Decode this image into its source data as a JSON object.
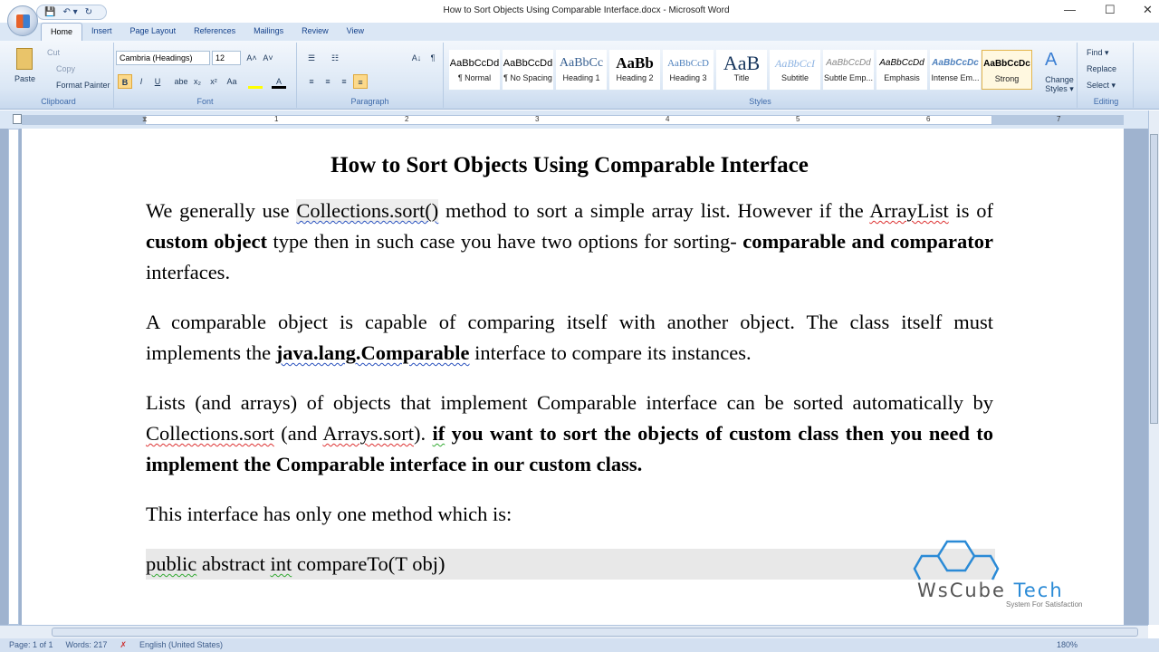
{
  "window": {
    "title": "How to Sort Objects Using Comparable Interface.docx - Microsoft Word",
    "minimize": "—",
    "maximize": "☐",
    "close": "✕"
  },
  "qat": {
    "save": "💾",
    "undo": "↶ ▾",
    "redo": "↻",
    "customize": "₹"
  },
  "tabs": [
    "Home",
    "Insert",
    "Page Layout",
    "References",
    "Mailings",
    "Review",
    "View"
  ],
  "clipboard": {
    "paste": "Paste",
    "cut": "Cut",
    "copy": "Copy",
    "format_painter": "Format Painter",
    "label": "Clipboard"
  },
  "font": {
    "name": "Cambria (Headings)",
    "size": "12",
    "label": "Font",
    "bold": "B",
    "italic": "I",
    "underline": "U",
    "strike": "abe",
    "sub": "x₂",
    "sup": "x²",
    "case": "Aa",
    "grow": "A˄",
    "shrink": "A˅",
    "color": "A"
  },
  "paragraph": {
    "label": "Paragraph",
    "pilcrow": "¶",
    "sort": "A↓"
  },
  "styles": {
    "label": "Styles",
    "items": [
      {
        "preview": "AaBbCcDd",
        "name": "¶ Normal"
      },
      {
        "preview": "AaBbCcDd",
        "name": "¶ No Spacing"
      },
      {
        "preview": "AaBbCc",
        "name": "Heading 1"
      },
      {
        "preview": "AaBb",
        "name": "Heading 2"
      },
      {
        "preview": "AaBbCcD",
        "name": "Heading 3"
      },
      {
        "preview": "AaB",
        "name": "Title"
      },
      {
        "preview": "AaBbCcI",
        "name": "Subtitle"
      },
      {
        "preview": "AaBbCcDd",
        "name": "Subtle Emp..."
      },
      {
        "preview": "AaBbCcDd",
        "name": "Emphasis"
      },
      {
        "preview": "AaBbCcDc",
        "name": "Intense Em..."
      },
      {
        "preview": "AaBbCcDc",
        "name": "Strong"
      }
    ],
    "change_styles": "Change Styles ▾"
  },
  "editing": {
    "label": "Editing",
    "find": "Find ▾",
    "replace": "Replace",
    "select": "Select ▾"
  },
  "ruler": [
    "1",
    "1",
    "2",
    "3",
    "4",
    "5",
    "6",
    "7"
  ],
  "document": {
    "title": "How to Sort Objects Using Comparable Interface",
    "p1": [
      "We generally use ",
      "Collections.sort()",
      " method to sort a simple array list. However if the ",
      "ArrayList",
      " is of ",
      "custom object",
      " type then in such case you have two options for sorting- ",
      "comparable and comparator",
      " interfaces."
    ],
    "p2": [
      "A comparable object is capable of comparing itself with another object. The class itself must implements the ",
      "java.lang.Comparable",
      " interface to compare its instances."
    ],
    "p3": [
      "Lists (and arrays) of objects that implement Comparable interface can be sorted automatically by ",
      "Collections.sort",
      " (and ",
      "Arrays.sort",
      "). ",
      "if",
      " you want to sort the objects of custom class then you need to implement the Comparable interface in our custom class."
    ],
    "p4": "This interface has only one method which is:",
    "code": [
      "public",
      " abstract ",
      "int",
      " compareTo(T obj)"
    ]
  },
  "watermark": {
    "brand_a": "WsCube ",
    "brand_b": "Tech",
    "tagline": "System For Satisfaction"
  },
  "status": {
    "page": "Page: 1 of 1",
    "words": "Words: 217",
    "language": "English (United States)",
    "zoom": "180%"
  }
}
